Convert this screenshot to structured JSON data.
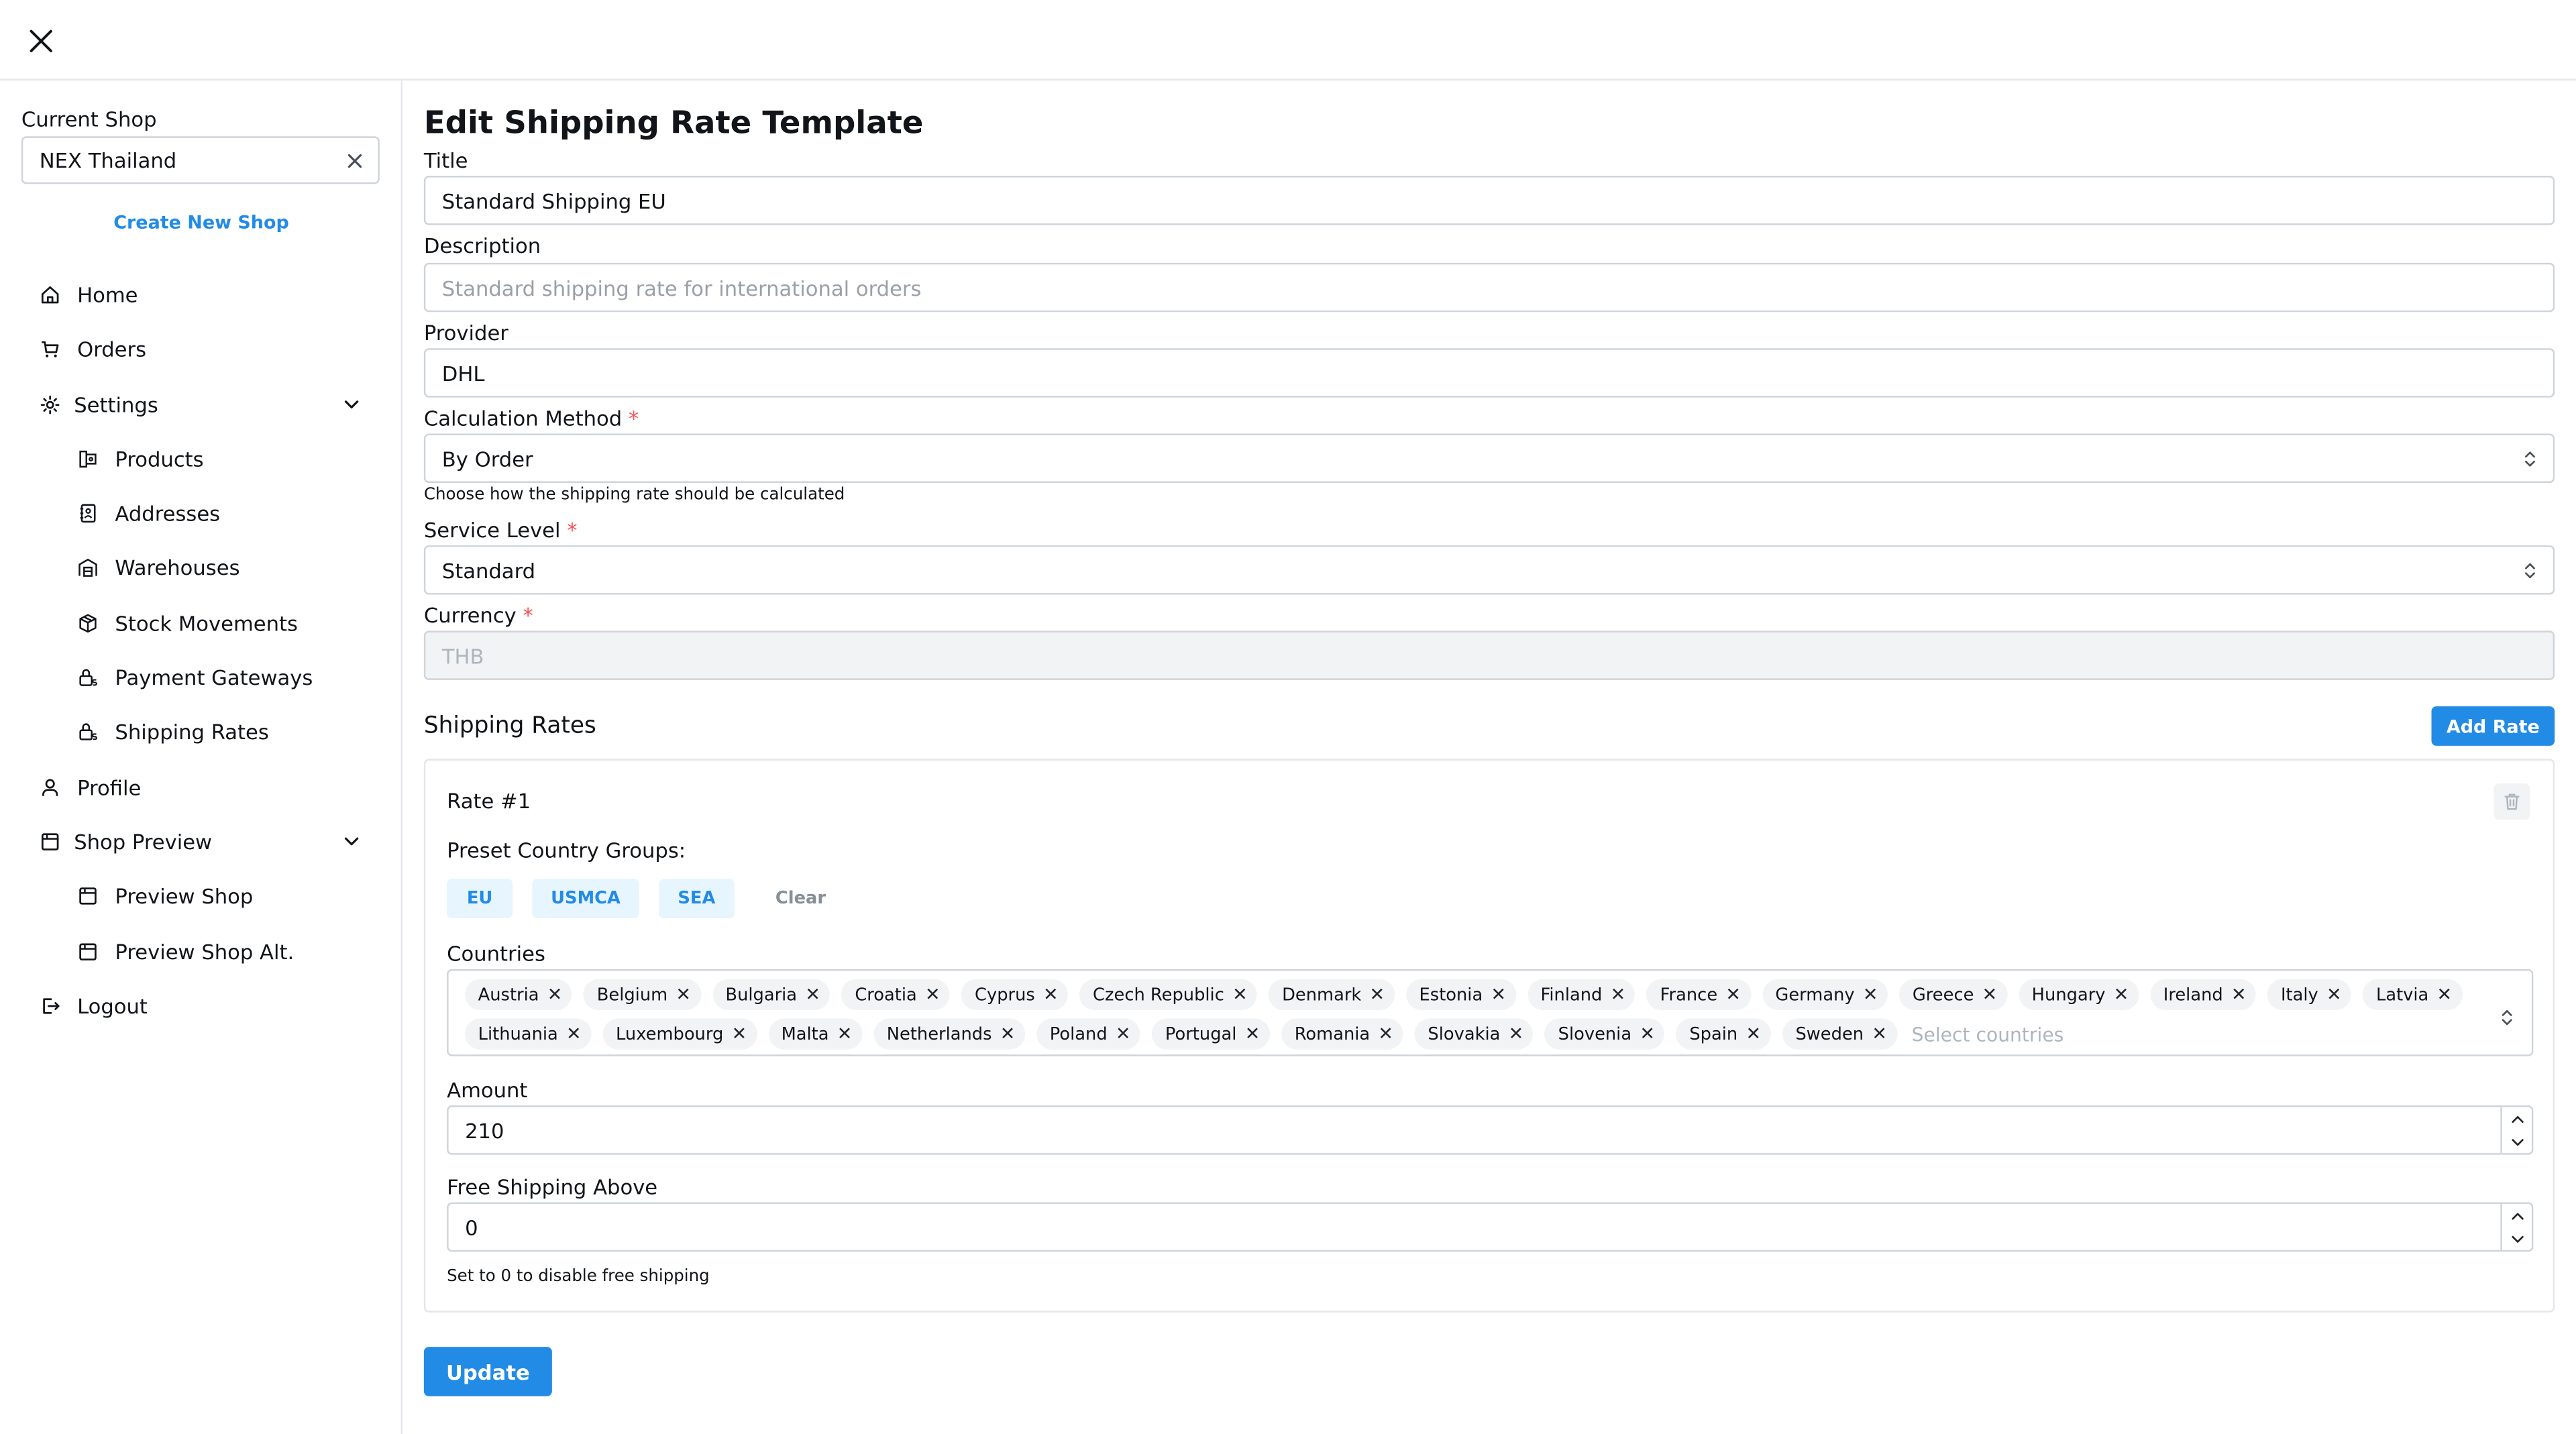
{
  "sidebar": {
    "current_shop_label": "Current Shop",
    "current_shop_value": "NEX Thailand",
    "create_shop_label": "Create New Shop",
    "nav": {
      "home": "Home",
      "orders": "Orders",
      "settings": "Settings",
      "products": "Products",
      "addresses": "Addresses",
      "warehouses": "Warehouses",
      "stock_movements": "Stock Movements",
      "payment_gateways": "Payment Gateways",
      "shipping_rates": "Shipping Rates",
      "profile": "Profile",
      "shop_preview": "Shop Preview",
      "preview_shop": "Preview Shop",
      "preview_shop_alt": "Preview Shop Alt.",
      "logout": "Logout"
    }
  },
  "form": {
    "page_title": "Edit Shipping Rate Template",
    "title_label": "Title",
    "title_value": "Standard Shipping EU",
    "description_label": "Description",
    "description_placeholder": "Standard shipping rate for international orders",
    "provider_label": "Provider",
    "provider_value": "DHL",
    "calc_method_label": "Calculation Method",
    "calc_method_value": "By Order",
    "calc_method_hint": "Choose how the shipping rate should be calculated",
    "service_level_label": "Service Level",
    "service_level_value": "Standard",
    "currency_label": "Currency",
    "currency_value": "THB",
    "required_mark": "*",
    "update_label": "Update"
  },
  "rates": {
    "section_title": "Shipping Rates",
    "add_rate_label": "Add Rate",
    "rate_title": "Rate #1",
    "preset_label": "Preset Country Groups:",
    "presets": [
      "EU",
      "USMCA",
      "SEA"
    ],
    "preset_clear": "Clear",
    "countries_label": "Countries",
    "countries": [
      "Austria",
      "Belgium",
      "Bulgaria",
      "Croatia",
      "Cyprus",
      "Czech Republic",
      "Denmark",
      "Estonia",
      "Finland",
      "France",
      "Germany",
      "Greece",
      "Hungary",
      "Ireland",
      "Italy",
      "Latvia",
      "Lithuania",
      "Luxembourg",
      "Malta",
      "Netherlands",
      "Poland",
      "Portugal",
      "Romania",
      "Slovakia",
      "Slovenia",
      "Spain",
      "Sweden"
    ],
    "countries_placeholder": "Select countries",
    "amount_label": "Amount",
    "amount_value": "210",
    "free_shipping_label": "Free Shipping Above",
    "free_shipping_value": "0",
    "free_shipping_hint": "Set to 0 to disable free shipping"
  },
  "colors": {
    "accent": "#228be6",
    "required": "#fa5252",
    "border": "#ced4da",
    "pill_bg": "#f1f3f5",
    "preset_bg": "#e7f5ff"
  },
  "icons": {
    "close": "close-icon",
    "home": "home-icon",
    "orders": "cart-icon",
    "settings": "gear-icon",
    "products": "tag-icon",
    "addresses": "address-book-icon",
    "warehouses": "building-warehouse-icon",
    "stock_movements": "package-icon",
    "payment_gateways": "lock-dollar-icon",
    "shipping_rates": "lock-dollar-icon",
    "profile": "user-icon",
    "shop_preview": "browser-icon",
    "logout": "logout-icon",
    "trash": "trash-icon"
  }
}
